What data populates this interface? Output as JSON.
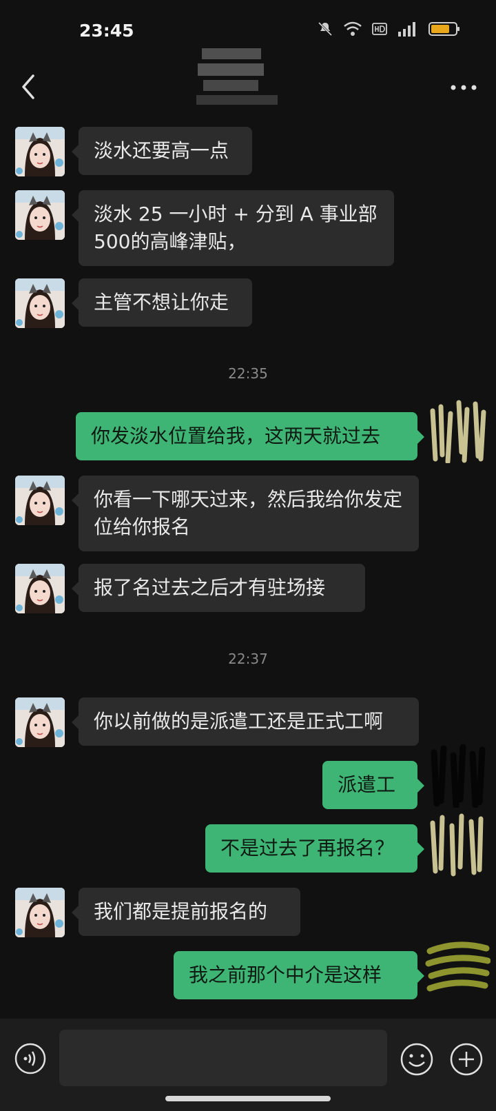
{
  "status_bar": {
    "time": "23:45",
    "icons": [
      "mute-icon",
      "wifi-icon",
      "hd-icon",
      "signal-4g-icon",
      "battery-icon"
    ],
    "battery_color": "#e9a81c"
  },
  "header": {
    "back_icon": "chevron-left-icon",
    "more_icon": "more-icon"
  },
  "colors": {
    "background": "#111111",
    "incoming_bubble": "#2c2c2c",
    "outgoing_bubble": "#3eb575"
  },
  "messages": [
    {
      "side": "in",
      "text": "淡水还要高一点"
    },
    {
      "side": "in",
      "text": "淡水 25 一小时 + 分到 A 事业部 500的高峰津贴，"
    },
    {
      "side": "in",
      "text": "主管不想让你走"
    },
    {
      "type": "time",
      "text": "22:35"
    },
    {
      "side": "out",
      "text": "你发淡水位置给我，这两天就过去"
    },
    {
      "side": "in",
      "text": "你看一下哪天过来，然后我给你发定位给你报名"
    },
    {
      "side": "in",
      "text": "报了名过去之后才有驻场接"
    },
    {
      "type": "time",
      "text": "22:37"
    },
    {
      "side": "in",
      "text": "你以前做的是派遣工还是正式工啊"
    },
    {
      "side": "out",
      "text": "派遣工"
    },
    {
      "side": "out",
      "text": "不是过去了再报名？"
    },
    {
      "side": "in",
      "text": "我们都是提前报名的"
    },
    {
      "side": "out",
      "text": "我之前那个中介是这样"
    }
  ],
  "input_bar": {
    "voice_icon": "voice-icon",
    "emoji_icon": "emoji-icon",
    "plus_icon": "plus-icon"
  }
}
